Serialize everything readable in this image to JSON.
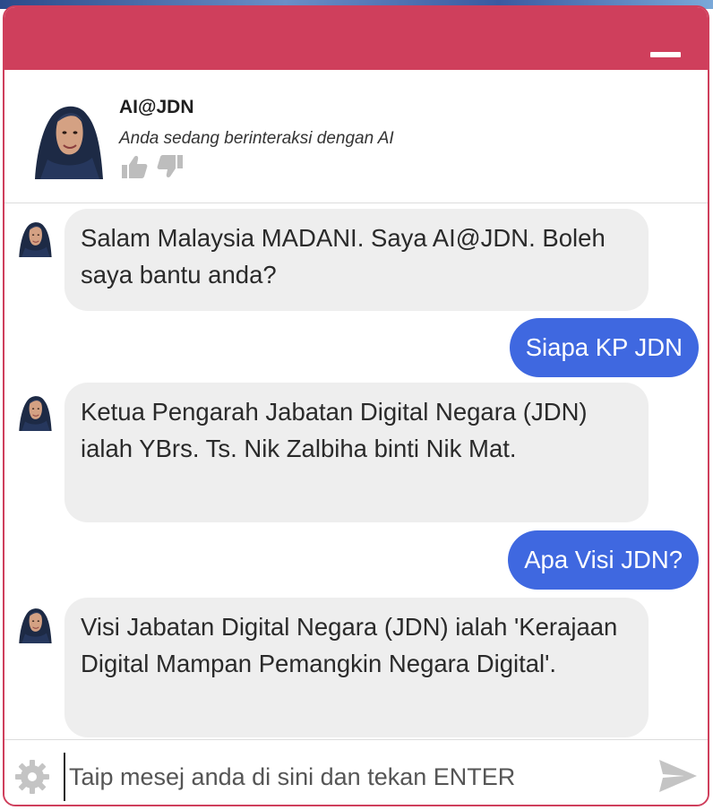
{
  "agent": {
    "name": "AI@JDN",
    "subtitle": "Anda sedang berinteraksi dengan AI"
  },
  "messages": [
    {
      "role": "bot",
      "text": "Salam Malaysia MADANI. Saya AI@JDN. Boleh saya bantu anda?"
    },
    {
      "role": "user",
      "text": "Siapa KP JDN"
    },
    {
      "role": "bot",
      "text": "Ketua Pengarah Jabatan Digital Negara (JDN) ialah YBrs. Ts. Nik Zalbiha binti Nik Mat."
    },
    {
      "role": "user",
      "text": "Apa Visi JDN?"
    },
    {
      "role": "bot",
      "text": "Visi Jabatan Digital Negara (JDN) ialah 'Kerajaan Digital Mampan Pemangkin Negara Digital'."
    }
  ],
  "input": {
    "placeholder": "Taip mesej anda di sini dan tekan ENTER",
    "value": ""
  },
  "colors": {
    "header": "#cf3f5c",
    "user_bubble": "#3f68e0",
    "bot_bubble": "#eeeeee"
  },
  "icons": {
    "minimize": "minimize-icon",
    "like": "thumbs-up-icon",
    "dislike": "thumbs-down-icon",
    "settings": "gear-icon",
    "send": "send-icon"
  }
}
